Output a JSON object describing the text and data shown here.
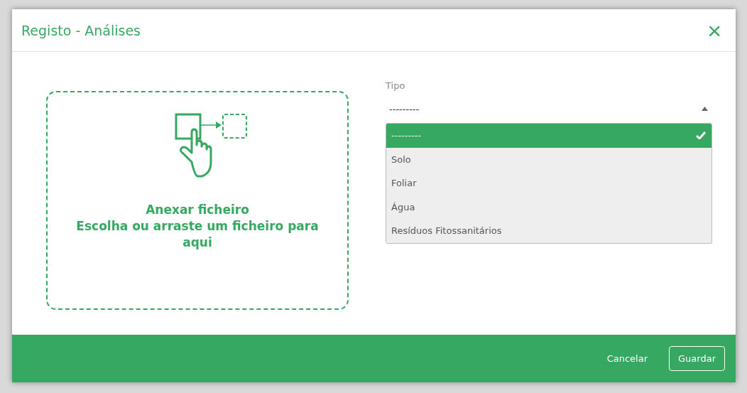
{
  "dialog": {
    "title": "Registo - Análises",
    "close": "×"
  },
  "dropzone": {
    "title": "Anexar ficheiro",
    "hint": "Escolha ou arraste um ficheiro para aqui"
  },
  "tipo": {
    "label": "Tipo",
    "value": "---------",
    "expanded": true,
    "options": [
      {
        "label": "---------",
        "selected": true
      },
      {
        "label": "Solo",
        "selected": false
      },
      {
        "label": "Foliar",
        "selected": false
      },
      {
        "label": "Água",
        "selected": false
      },
      {
        "label": "Resíduos Fitossanitários",
        "selected": false
      }
    ]
  },
  "buttons": [
    {
      "label": "Cancelar",
      "kind": "text"
    },
    {
      "label": "Guardar",
      "kind": "outline"
    }
  ]
}
